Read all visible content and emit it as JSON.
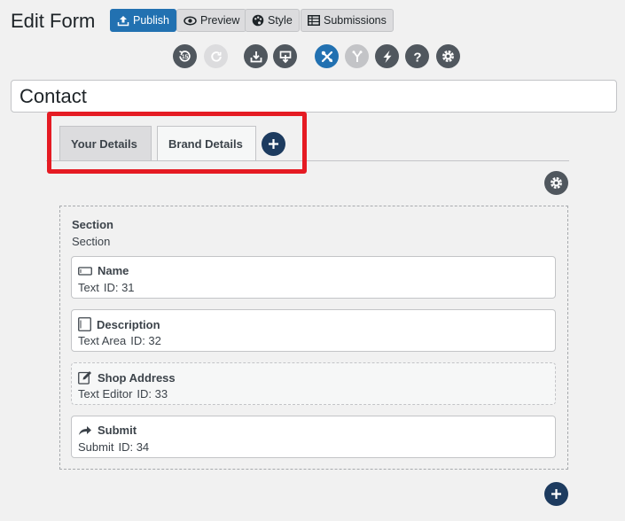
{
  "header": {
    "title": "Edit Form",
    "buttons": [
      {
        "label": "Publish",
        "icon": "upload-icon"
      },
      {
        "label": "Preview",
        "icon": "eye-icon"
      },
      {
        "label": "Style",
        "icon": "palette-icon"
      },
      {
        "label": "Submissions",
        "icon": "table-icon"
      }
    ]
  },
  "toolbar": [
    {
      "icon": "history-icon"
    },
    {
      "icon": "redo-icon"
    },
    {
      "icon": "import-icon"
    },
    {
      "icon": "export-icon"
    },
    {
      "icon": "tools-icon"
    },
    {
      "icon": "branch-icon"
    },
    {
      "icon": "lightning-icon"
    },
    {
      "icon": "help-icon"
    },
    {
      "icon": "settings-icon"
    }
  ],
  "form": {
    "title": "Contact"
  },
  "tabs": [
    {
      "label": "Your Details",
      "active": true
    },
    {
      "label": "Brand Details",
      "active": false
    }
  ],
  "section": {
    "title": "Section",
    "subtitle": "Section",
    "fields": [
      {
        "name": "Name",
        "type": "Text",
        "id_label": "ID: 31",
        "icon": "text-field-icon"
      },
      {
        "name": "Description",
        "type": "Text Area",
        "id_label": "ID: 32",
        "icon": "textarea-icon"
      },
      {
        "name": "Shop Address",
        "type": "Text Editor",
        "id_label": "ID: 33",
        "icon": "edit-icon"
      },
      {
        "name": "Submit",
        "type": "Submit",
        "id_label": "ID: 34",
        "icon": "share-arrow-icon"
      }
    ]
  },
  "colors": {
    "accent": "#2271b1",
    "highlight": "#e51b23",
    "dark_button": "#1d3b5f"
  }
}
